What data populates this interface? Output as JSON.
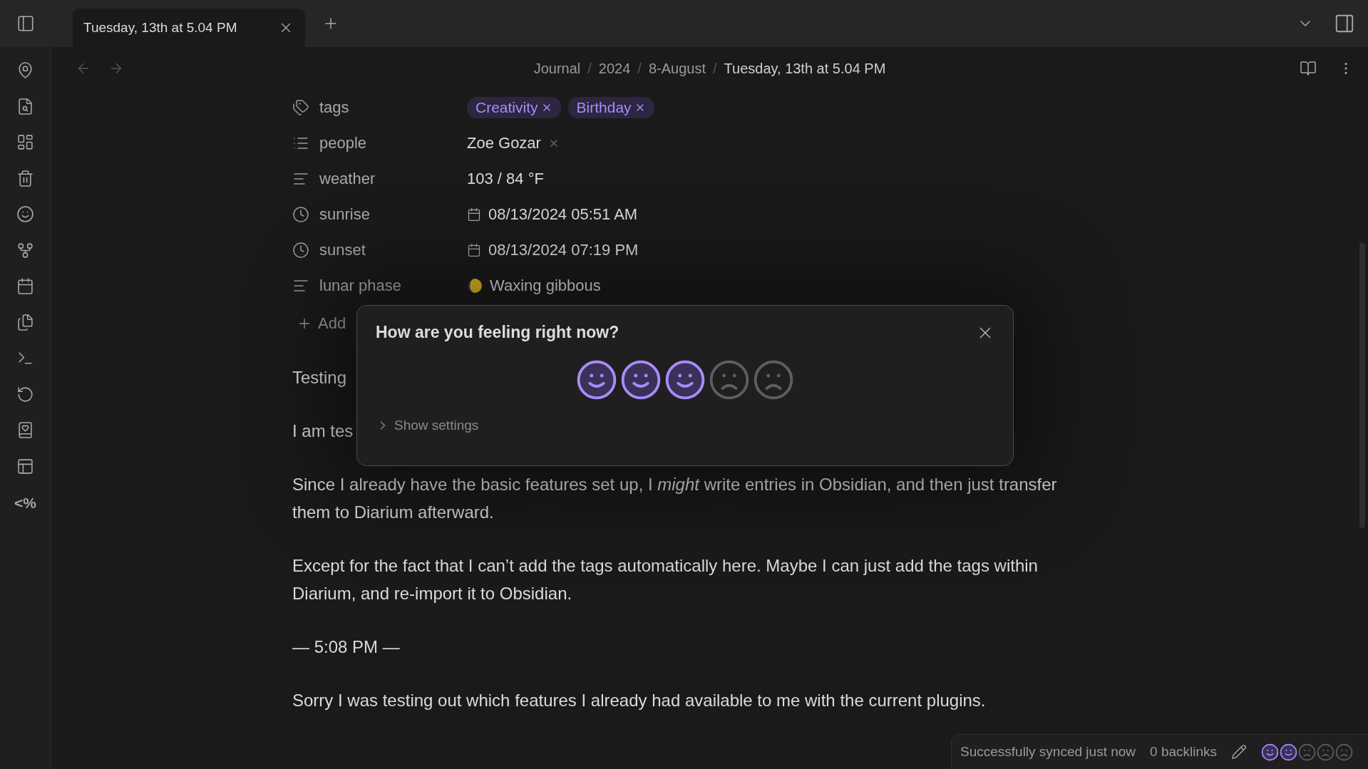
{
  "tab": {
    "title": "Tuesday, 13th at 5.04 PM",
    "selected": true
  },
  "ribbon": {
    "template_label": "<%"
  },
  "breadcrumb": [
    "Journal",
    "2024",
    "8-August",
    "Tuesday, 13th at 5.04 PM"
  ],
  "breadcrumb_separator": "/",
  "properties": [
    {
      "kind": "tags",
      "label": "tags",
      "values": [
        "Creativity",
        "Birthday"
      ]
    },
    {
      "kind": "list",
      "label": "people",
      "values": [
        "Zoe Gozar"
      ]
    },
    {
      "kind": "text",
      "label": "weather",
      "value": "103 / 84 °F"
    },
    {
      "kind": "datetime",
      "label": "sunrise",
      "value": "08/13/2024 05:51 AM"
    },
    {
      "kind": "datetime",
      "label": "sunset",
      "value": "08/13/2024 07:19 PM"
    },
    {
      "kind": "moon",
      "label": "lunar phase",
      "value": "Waxing gibbous"
    }
  ],
  "add_property": "Add",
  "paragraphs": [
    {
      "kind": "text",
      "text": "Testing"
    },
    {
      "kind": "text",
      "text": "I am tes"
    },
    {
      "kind": "text",
      "text": "Since I already have the basic features set up, I *might* write entries in Obsidian, and then just transfer them to Diarium afterward."
    },
    {
      "kind": "text",
      "text": "Except for the fact that I can’t add the tags automatically here. Maybe I can just add the tags within Diarium, and re-import it to Obsidian."
    },
    {
      "kind": "text",
      "text": "— 5:08 PM —"
    },
    {
      "kind": "text",
      "text": "Sorry I was testing out which features I already had available to me with the current plugins."
    }
  ],
  "modal": {
    "title": "How are you feeling right now?",
    "stars": 3,
    "settings_label": "Show settings"
  },
  "status_bar": {
    "sync": "Successfully synced just now",
    "backlinks": "0 backlinks",
    "stars": 2
  }
}
